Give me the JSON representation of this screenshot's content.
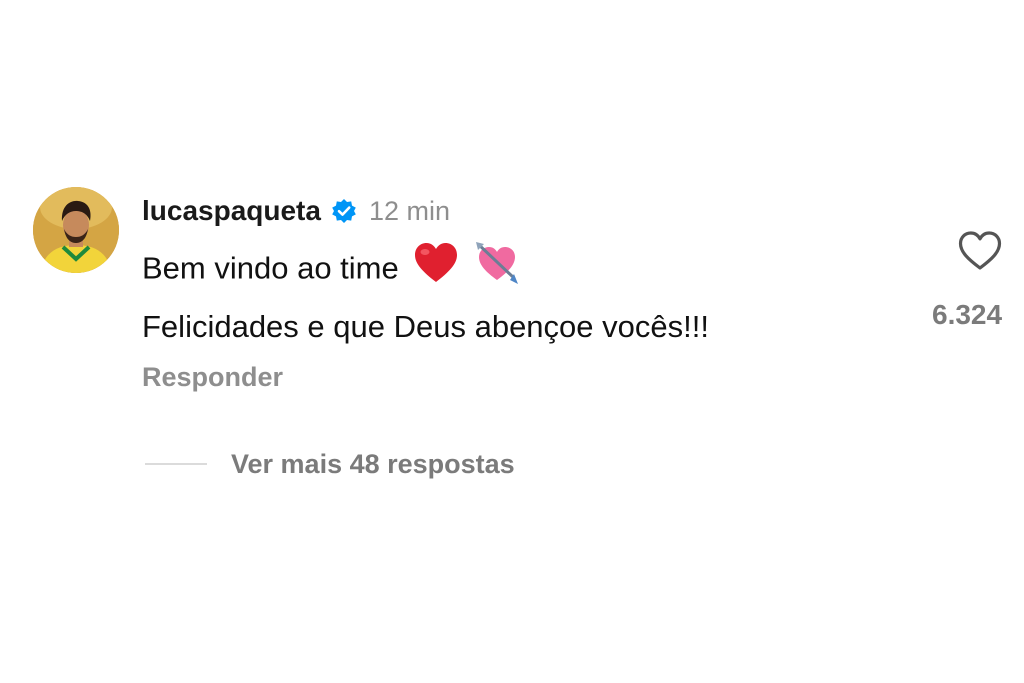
{
  "comment": {
    "avatar_icon": "user-avatar-photo",
    "username": "lucaspaqueta",
    "verified_icon": "verified-badge-icon",
    "timestamp": "12 min",
    "line1": "Bem vindo ao time",
    "line1_emojis": [
      "red-heart-emoji",
      "heart-with-arrow-emoji"
    ],
    "line2": "Felicidades e que Deus abençoe vocês!!!",
    "reply_label": "Responder",
    "like_icon": "heart-outline-icon",
    "like_count": "6.324",
    "view_replies_label": "Ver mais 48 respostas"
  },
  "colors": {
    "text": "#111111",
    "muted": "#8e8e8e",
    "verified_blue": "#0095f6",
    "heart_red": "#e0202f",
    "heart_pink": "#f06aa0"
  }
}
